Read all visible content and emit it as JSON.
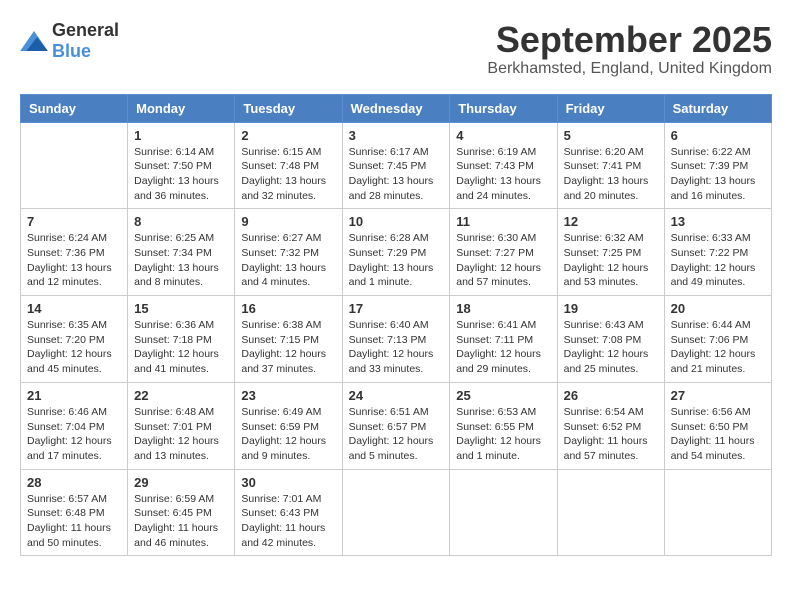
{
  "logo": {
    "general": "General",
    "blue": "Blue"
  },
  "title": "September 2025",
  "location": "Berkhamsted, England, United Kingdom",
  "weekdays": [
    "Sunday",
    "Monday",
    "Tuesday",
    "Wednesday",
    "Thursday",
    "Friday",
    "Saturday"
  ],
  "weeks": [
    [
      {
        "day": "",
        "info": ""
      },
      {
        "day": "1",
        "info": "Sunrise: 6:14 AM\nSunset: 7:50 PM\nDaylight: 13 hours\nand 36 minutes."
      },
      {
        "day": "2",
        "info": "Sunrise: 6:15 AM\nSunset: 7:48 PM\nDaylight: 13 hours\nand 32 minutes."
      },
      {
        "day": "3",
        "info": "Sunrise: 6:17 AM\nSunset: 7:45 PM\nDaylight: 13 hours\nand 28 minutes."
      },
      {
        "day": "4",
        "info": "Sunrise: 6:19 AM\nSunset: 7:43 PM\nDaylight: 13 hours\nand 24 minutes."
      },
      {
        "day": "5",
        "info": "Sunrise: 6:20 AM\nSunset: 7:41 PM\nDaylight: 13 hours\nand 20 minutes."
      },
      {
        "day": "6",
        "info": "Sunrise: 6:22 AM\nSunset: 7:39 PM\nDaylight: 13 hours\nand 16 minutes."
      }
    ],
    [
      {
        "day": "7",
        "info": "Sunrise: 6:24 AM\nSunset: 7:36 PM\nDaylight: 13 hours\nand 12 minutes."
      },
      {
        "day": "8",
        "info": "Sunrise: 6:25 AM\nSunset: 7:34 PM\nDaylight: 13 hours\nand 8 minutes."
      },
      {
        "day": "9",
        "info": "Sunrise: 6:27 AM\nSunset: 7:32 PM\nDaylight: 13 hours\nand 4 minutes."
      },
      {
        "day": "10",
        "info": "Sunrise: 6:28 AM\nSunset: 7:29 PM\nDaylight: 13 hours\nand 1 minute."
      },
      {
        "day": "11",
        "info": "Sunrise: 6:30 AM\nSunset: 7:27 PM\nDaylight: 12 hours\nand 57 minutes."
      },
      {
        "day": "12",
        "info": "Sunrise: 6:32 AM\nSunset: 7:25 PM\nDaylight: 12 hours\nand 53 minutes."
      },
      {
        "day": "13",
        "info": "Sunrise: 6:33 AM\nSunset: 7:22 PM\nDaylight: 12 hours\nand 49 minutes."
      }
    ],
    [
      {
        "day": "14",
        "info": "Sunrise: 6:35 AM\nSunset: 7:20 PM\nDaylight: 12 hours\nand 45 minutes."
      },
      {
        "day": "15",
        "info": "Sunrise: 6:36 AM\nSunset: 7:18 PM\nDaylight: 12 hours\nand 41 minutes."
      },
      {
        "day": "16",
        "info": "Sunrise: 6:38 AM\nSunset: 7:15 PM\nDaylight: 12 hours\nand 37 minutes."
      },
      {
        "day": "17",
        "info": "Sunrise: 6:40 AM\nSunset: 7:13 PM\nDaylight: 12 hours\nand 33 minutes."
      },
      {
        "day": "18",
        "info": "Sunrise: 6:41 AM\nSunset: 7:11 PM\nDaylight: 12 hours\nand 29 minutes."
      },
      {
        "day": "19",
        "info": "Sunrise: 6:43 AM\nSunset: 7:08 PM\nDaylight: 12 hours\nand 25 minutes."
      },
      {
        "day": "20",
        "info": "Sunrise: 6:44 AM\nSunset: 7:06 PM\nDaylight: 12 hours\nand 21 minutes."
      }
    ],
    [
      {
        "day": "21",
        "info": "Sunrise: 6:46 AM\nSunset: 7:04 PM\nDaylight: 12 hours\nand 17 minutes."
      },
      {
        "day": "22",
        "info": "Sunrise: 6:48 AM\nSunset: 7:01 PM\nDaylight: 12 hours\nand 13 minutes."
      },
      {
        "day": "23",
        "info": "Sunrise: 6:49 AM\nSunset: 6:59 PM\nDaylight: 12 hours\nand 9 minutes."
      },
      {
        "day": "24",
        "info": "Sunrise: 6:51 AM\nSunset: 6:57 PM\nDaylight: 12 hours\nand 5 minutes."
      },
      {
        "day": "25",
        "info": "Sunrise: 6:53 AM\nSunset: 6:55 PM\nDaylight: 12 hours\nand 1 minute."
      },
      {
        "day": "26",
        "info": "Sunrise: 6:54 AM\nSunset: 6:52 PM\nDaylight: 11 hours\nand 57 minutes."
      },
      {
        "day": "27",
        "info": "Sunrise: 6:56 AM\nSunset: 6:50 PM\nDaylight: 11 hours\nand 54 minutes."
      }
    ],
    [
      {
        "day": "28",
        "info": "Sunrise: 6:57 AM\nSunset: 6:48 PM\nDaylight: 11 hours\nand 50 minutes."
      },
      {
        "day": "29",
        "info": "Sunrise: 6:59 AM\nSunset: 6:45 PM\nDaylight: 11 hours\nand 46 minutes."
      },
      {
        "day": "30",
        "info": "Sunrise: 7:01 AM\nSunset: 6:43 PM\nDaylight: 11 hours\nand 42 minutes."
      },
      {
        "day": "",
        "info": ""
      },
      {
        "day": "",
        "info": ""
      },
      {
        "day": "",
        "info": ""
      },
      {
        "day": "",
        "info": ""
      }
    ]
  ]
}
